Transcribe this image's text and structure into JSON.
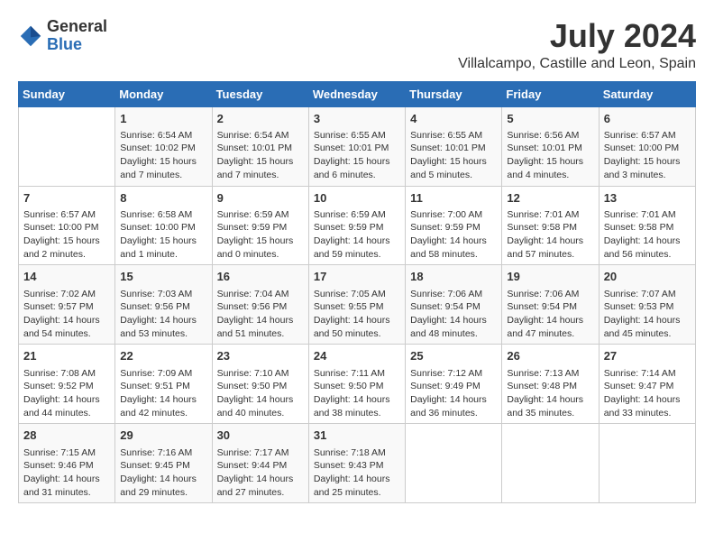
{
  "logo": {
    "general": "General",
    "blue": "Blue"
  },
  "title": {
    "month_year": "July 2024",
    "location": "Villalcampo, Castille and Leon, Spain"
  },
  "weekdays": [
    "Sunday",
    "Monday",
    "Tuesday",
    "Wednesday",
    "Thursday",
    "Friday",
    "Saturday"
  ],
  "weeks": [
    [
      {
        "day": "",
        "info": ""
      },
      {
        "day": "1",
        "info": "Sunrise: 6:54 AM\nSunset: 10:02 PM\nDaylight: 15 hours\nand 7 minutes."
      },
      {
        "day": "2",
        "info": "Sunrise: 6:54 AM\nSunset: 10:01 PM\nDaylight: 15 hours\nand 7 minutes."
      },
      {
        "day": "3",
        "info": "Sunrise: 6:55 AM\nSunset: 10:01 PM\nDaylight: 15 hours\nand 6 minutes."
      },
      {
        "day": "4",
        "info": "Sunrise: 6:55 AM\nSunset: 10:01 PM\nDaylight: 15 hours\nand 5 minutes."
      },
      {
        "day": "5",
        "info": "Sunrise: 6:56 AM\nSunset: 10:01 PM\nDaylight: 15 hours\nand 4 minutes."
      },
      {
        "day": "6",
        "info": "Sunrise: 6:57 AM\nSunset: 10:00 PM\nDaylight: 15 hours\nand 3 minutes."
      }
    ],
    [
      {
        "day": "7",
        "info": "Sunrise: 6:57 AM\nSunset: 10:00 PM\nDaylight: 15 hours\nand 2 minutes."
      },
      {
        "day": "8",
        "info": "Sunrise: 6:58 AM\nSunset: 10:00 PM\nDaylight: 15 hours\nand 1 minute."
      },
      {
        "day": "9",
        "info": "Sunrise: 6:59 AM\nSunset: 9:59 PM\nDaylight: 15 hours\nand 0 minutes."
      },
      {
        "day": "10",
        "info": "Sunrise: 6:59 AM\nSunset: 9:59 PM\nDaylight: 14 hours\nand 59 minutes."
      },
      {
        "day": "11",
        "info": "Sunrise: 7:00 AM\nSunset: 9:59 PM\nDaylight: 14 hours\nand 58 minutes."
      },
      {
        "day": "12",
        "info": "Sunrise: 7:01 AM\nSunset: 9:58 PM\nDaylight: 14 hours\nand 57 minutes."
      },
      {
        "day": "13",
        "info": "Sunrise: 7:01 AM\nSunset: 9:58 PM\nDaylight: 14 hours\nand 56 minutes."
      }
    ],
    [
      {
        "day": "14",
        "info": "Sunrise: 7:02 AM\nSunset: 9:57 PM\nDaylight: 14 hours\nand 54 minutes."
      },
      {
        "day": "15",
        "info": "Sunrise: 7:03 AM\nSunset: 9:56 PM\nDaylight: 14 hours\nand 53 minutes."
      },
      {
        "day": "16",
        "info": "Sunrise: 7:04 AM\nSunset: 9:56 PM\nDaylight: 14 hours\nand 51 minutes."
      },
      {
        "day": "17",
        "info": "Sunrise: 7:05 AM\nSunset: 9:55 PM\nDaylight: 14 hours\nand 50 minutes."
      },
      {
        "day": "18",
        "info": "Sunrise: 7:06 AM\nSunset: 9:54 PM\nDaylight: 14 hours\nand 48 minutes."
      },
      {
        "day": "19",
        "info": "Sunrise: 7:06 AM\nSunset: 9:54 PM\nDaylight: 14 hours\nand 47 minutes."
      },
      {
        "day": "20",
        "info": "Sunrise: 7:07 AM\nSunset: 9:53 PM\nDaylight: 14 hours\nand 45 minutes."
      }
    ],
    [
      {
        "day": "21",
        "info": "Sunrise: 7:08 AM\nSunset: 9:52 PM\nDaylight: 14 hours\nand 44 minutes."
      },
      {
        "day": "22",
        "info": "Sunrise: 7:09 AM\nSunset: 9:51 PM\nDaylight: 14 hours\nand 42 minutes."
      },
      {
        "day": "23",
        "info": "Sunrise: 7:10 AM\nSunset: 9:50 PM\nDaylight: 14 hours\nand 40 minutes."
      },
      {
        "day": "24",
        "info": "Sunrise: 7:11 AM\nSunset: 9:50 PM\nDaylight: 14 hours\nand 38 minutes."
      },
      {
        "day": "25",
        "info": "Sunrise: 7:12 AM\nSunset: 9:49 PM\nDaylight: 14 hours\nand 36 minutes."
      },
      {
        "day": "26",
        "info": "Sunrise: 7:13 AM\nSunset: 9:48 PM\nDaylight: 14 hours\nand 35 minutes."
      },
      {
        "day": "27",
        "info": "Sunrise: 7:14 AM\nSunset: 9:47 PM\nDaylight: 14 hours\nand 33 minutes."
      }
    ],
    [
      {
        "day": "28",
        "info": "Sunrise: 7:15 AM\nSunset: 9:46 PM\nDaylight: 14 hours\nand 31 minutes."
      },
      {
        "day": "29",
        "info": "Sunrise: 7:16 AM\nSunset: 9:45 PM\nDaylight: 14 hours\nand 29 minutes."
      },
      {
        "day": "30",
        "info": "Sunrise: 7:17 AM\nSunset: 9:44 PM\nDaylight: 14 hours\nand 27 minutes."
      },
      {
        "day": "31",
        "info": "Sunrise: 7:18 AM\nSunset: 9:43 PM\nDaylight: 14 hours\nand 25 minutes."
      },
      {
        "day": "",
        "info": ""
      },
      {
        "day": "",
        "info": ""
      },
      {
        "day": "",
        "info": ""
      }
    ]
  ]
}
